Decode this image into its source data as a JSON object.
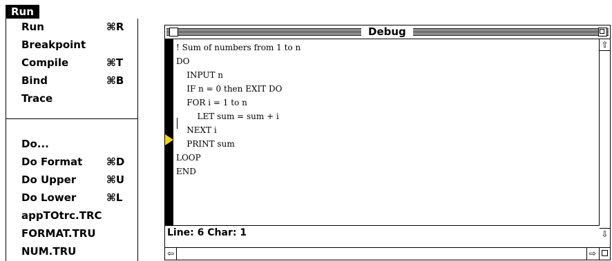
{
  "menubar": {
    "title": "Run"
  },
  "menu": {
    "items": [
      {
        "label": "Run",
        "shortcut": "⌘R"
      },
      {
        "label": "Breakpoint",
        "shortcut": ""
      },
      {
        "label": "Compile",
        "shortcut": "⌘T"
      },
      {
        "label": "Bind",
        "shortcut": "⌘B"
      },
      {
        "label": "Trace",
        "shortcut": ""
      },
      {
        "label": "Do...",
        "shortcut": ""
      },
      {
        "label": "Do Format",
        "shortcut": "⌘D"
      },
      {
        "label": "Do Upper",
        "shortcut": "⌘U"
      },
      {
        "label": "Do Lower",
        "shortcut": "⌘L"
      },
      {
        "label": "appTOtrc.TRC",
        "shortcut": ""
      },
      {
        "label": "FORMAT.TRU",
        "shortcut": ""
      },
      {
        "label": "NUM.TRU",
        "shortcut": ""
      }
    ]
  },
  "window": {
    "title": "Debug",
    "code_lines": [
      "! Sum of numbers from 1 to n",
      "DO",
      "    INPUT n",
      "    IF n = 0 then EXIT DO",
      "    FOR i = 1 to n",
      "        LET sum = sum + i",
      "    NEXT i",
      "    PRINT sum",
      "LOOP",
      "END"
    ],
    "status": "Line: 6 Char: 1",
    "breakpoint_color": "#ffd700"
  },
  "icons": {
    "scroll_up": "⇧",
    "scroll_down": "⇩",
    "scroll_left": "⇦",
    "scroll_right": "⇨"
  }
}
